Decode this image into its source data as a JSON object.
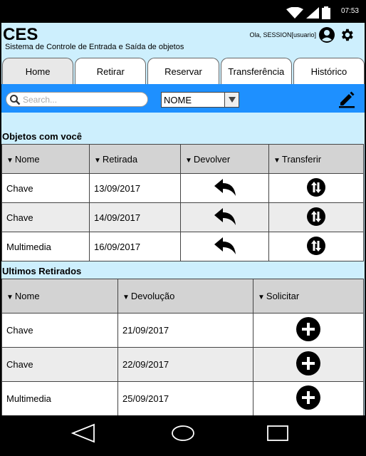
{
  "status": {
    "time": "07:53"
  },
  "app": {
    "title": "CES",
    "subtitle": "Sistema de Controle de Entrada e Saída de objetos",
    "greeting": "Ola, SESSION[usuario]"
  },
  "tabs": [
    {
      "label": "Home",
      "active": true
    },
    {
      "label": "Retirar"
    },
    {
      "label": "Reservar"
    },
    {
      "label": "Transferência"
    },
    {
      "label": "Histórico"
    }
  ],
  "search": {
    "placeholder": "Search...",
    "filter_value": "NOME"
  },
  "section1": {
    "title": "Objetos com você",
    "headers": [
      "Nome",
      "Retirada",
      "Devolver",
      "Transferir"
    ],
    "rows": [
      {
        "name": "Chave",
        "date": "13/09/2017"
      },
      {
        "name": "Chave",
        "date": "14/09/2017"
      },
      {
        "name": "Multimedia",
        "date": "16/09/2017"
      }
    ]
  },
  "section2": {
    "title": "Ultimos Retirados",
    "headers": [
      "Nome",
      "Devolução",
      "Solicitar"
    ],
    "rows": [
      {
        "name": "Chave",
        "date": "21/09/2017"
      },
      {
        "name": "Chave",
        "date": "22/09/2017"
      },
      {
        "name": "Multimedia",
        "date": "25/09/2017"
      }
    ]
  },
  "colors": {
    "screen_bg": "#cdeffd",
    "toolbar_blue": "#1e90ff",
    "header_gray": "#d3d3d3"
  }
}
